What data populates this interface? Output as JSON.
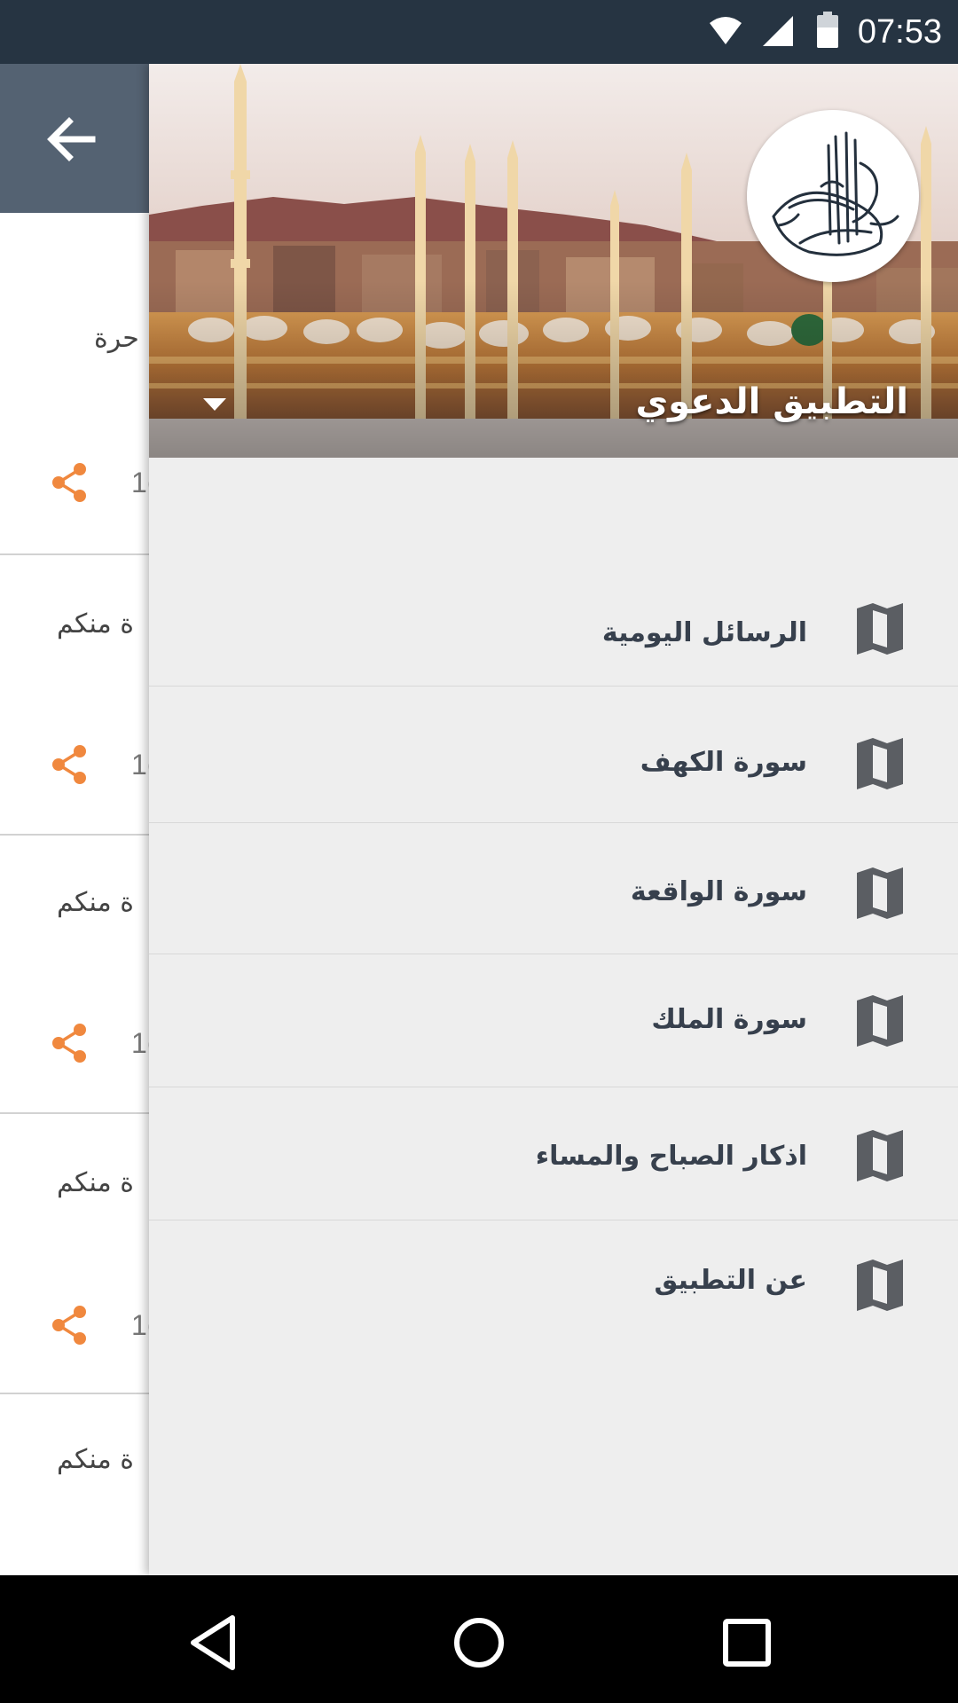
{
  "status_bar": {
    "time": "07:53",
    "icons": [
      "wifi-icon",
      "signal-icon",
      "battery-icon"
    ]
  },
  "background_app": {
    "toolbar": {
      "back_icon": "arrow-back-icon",
      "color": "#546272"
    },
    "cards": [
      {
        "text": "حرة",
        "count": "1("
      },
      {
        "text": "ة منكم",
        "count": "1("
      },
      {
        "text": "ة منكم",
        "count": "1("
      },
      {
        "text": "ة منكم",
        "count": "1("
      },
      {
        "text": "ة منكم",
        "count": "1("
      }
    ],
    "share_icon": "share-icon",
    "accent_color": "#f0883e"
  },
  "drawer": {
    "header": {
      "app_name": "التطبيق الدعوي",
      "avatar_icon": "calligraphy-logo",
      "dropdown_icon": "dropdown-arrow-icon"
    },
    "menu_items": [
      {
        "label": "الرسائل اليومية",
        "icon": "book-icon"
      },
      {
        "label": "سورة الكهف",
        "icon": "book-icon"
      },
      {
        "label": "سورة الواقعة",
        "icon": "book-icon"
      },
      {
        "label": "سورة الملك",
        "icon": "book-icon"
      },
      {
        "label": "اذكار الصباح والمساء",
        "icon": "book-icon"
      },
      {
        "label": "عن التطبيق",
        "icon": "book-icon"
      }
    ],
    "background_color": "#eeeeee",
    "text_color": "#37404d"
  },
  "nav_bar": {
    "buttons": [
      "back-triangle-icon",
      "home-circle-icon",
      "recents-square-icon"
    ]
  }
}
